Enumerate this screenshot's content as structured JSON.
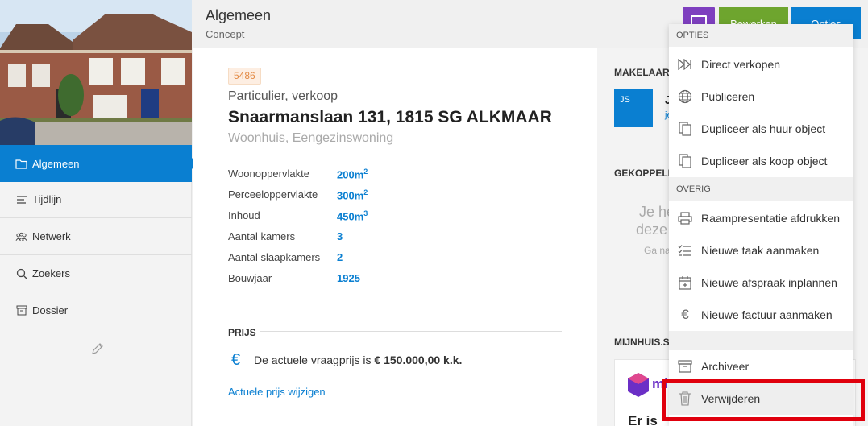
{
  "header": {
    "title": "Algemeen",
    "subtitle": "Concept",
    "edit_label": "Bewerken",
    "options_label": "Opties"
  },
  "sidebar": {
    "items": [
      {
        "label": "Algemeen",
        "icon": "folder-icon",
        "active": true
      },
      {
        "label": "Tijdlijn",
        "icon": "timeline-icon",
        "active": false
      },
      {
        "label": "Netwerk",
        "icon": "network-icon",
        "active": false
      },
      {
        "label": "Zoekers",
        "icon": "search-icon",
        "active": false
      },
      {
        "label": "Dossier",
        "icon": "archive-box-icon",
        "active": false
      }
    ]
  },
  "property": {
    "reference": "5486",
    "listing_type": "Particulier, verkoop",
    "address": "Snaarmanslaan 131, 1815 SG ALKMAAR",
    "house_type": "Woonhuis, Eengezinswoning",
    "specs": [
      {
        "label": "Woonoppervlakte",
        "value": "200m",
        "sup": "2"
      },
      {
        "label": "Perceeloppervlakte",
        "value": "300m",
        "sup": "2"
      },
      {
        "label": "Inhoud",
        "value": "450m",
        "sup": "3"
      },
      {
        "label": "Aantal kamers",
        "value": "3",
        "sup": ""
      },
      {
        "label": "Aantal slaapkamers",
        "value": "2",
        "sup": ""
      },
      {
        "label": "Bouwjaar",
        "value": "1925",
        "sup": ""
      }
    ]
  },
  "price": {
    "heading": "PRIJS",
    "text_prefix": "De actuele vraagprijs is ",
    "amount": "€ 150.000,00 k.k.",
    "link": "Actuele prijs wijzigen"
  },
  "right_column": {
    "makelaar_head": "MAKELAAR",
    "agent_initials": "JS",
    "agent_name_initial": "J",
    "agent_link": "je",
    "gekoppeld_head": "GEKOPPELD",
    "faded_line1": "Je he",
    "faded_line2": "deze",
    "faded_line3": "Ga na",
    "mijnhuis_head": "MIJNHUIS.S",
    "mijnhuis_logo_text": "mi",
    "mijnhuis_er": "Er is"
  },
  "dropdown": {
    "section_opties": "OPTIES",
    "section_overig": "OVERIG",
    "items_opties": [
      {
        "label": "Direct verkopen",
        "icon": "fast-forward-icon"
      },
      {
        "label": "Publiceren",
        "icon": "globe-icon"
      },
      {
        "label": "Dupliceer als huur object",
        "icon": "copy-icon"
      },
      {
        "label": "Dupliceer als koop object",
        "icon": "copy-icon"
      }
    ],
    "items_overig": [
      {
        "label": "Raampresentatie afdrukken",
        "icon": "printer-icon"
      },
      {
        "label": "Nieuwe taak aanmaken",
        "icon": "checklist-icon"
      },
      {
        "label": "Nieuwe afspraak inplannen",
        "icon": "calendar-plus-icon"
      },
      {
        "label": "Nieuwe factuur aanmaken",
        "icon": "euro-icon"
      }
    ],
    "archive_label": "Archiveer",
    "delete_label": "Verwijderen"
  },
  "colors": {
    "primary": "#0a7fd1",
    "edit_green": "#6ea52e",
    "purple": "#7e3fbf",
    "highlight_red": "#e0000d",
    "badge_orange": "#e38a44"
  }
}
